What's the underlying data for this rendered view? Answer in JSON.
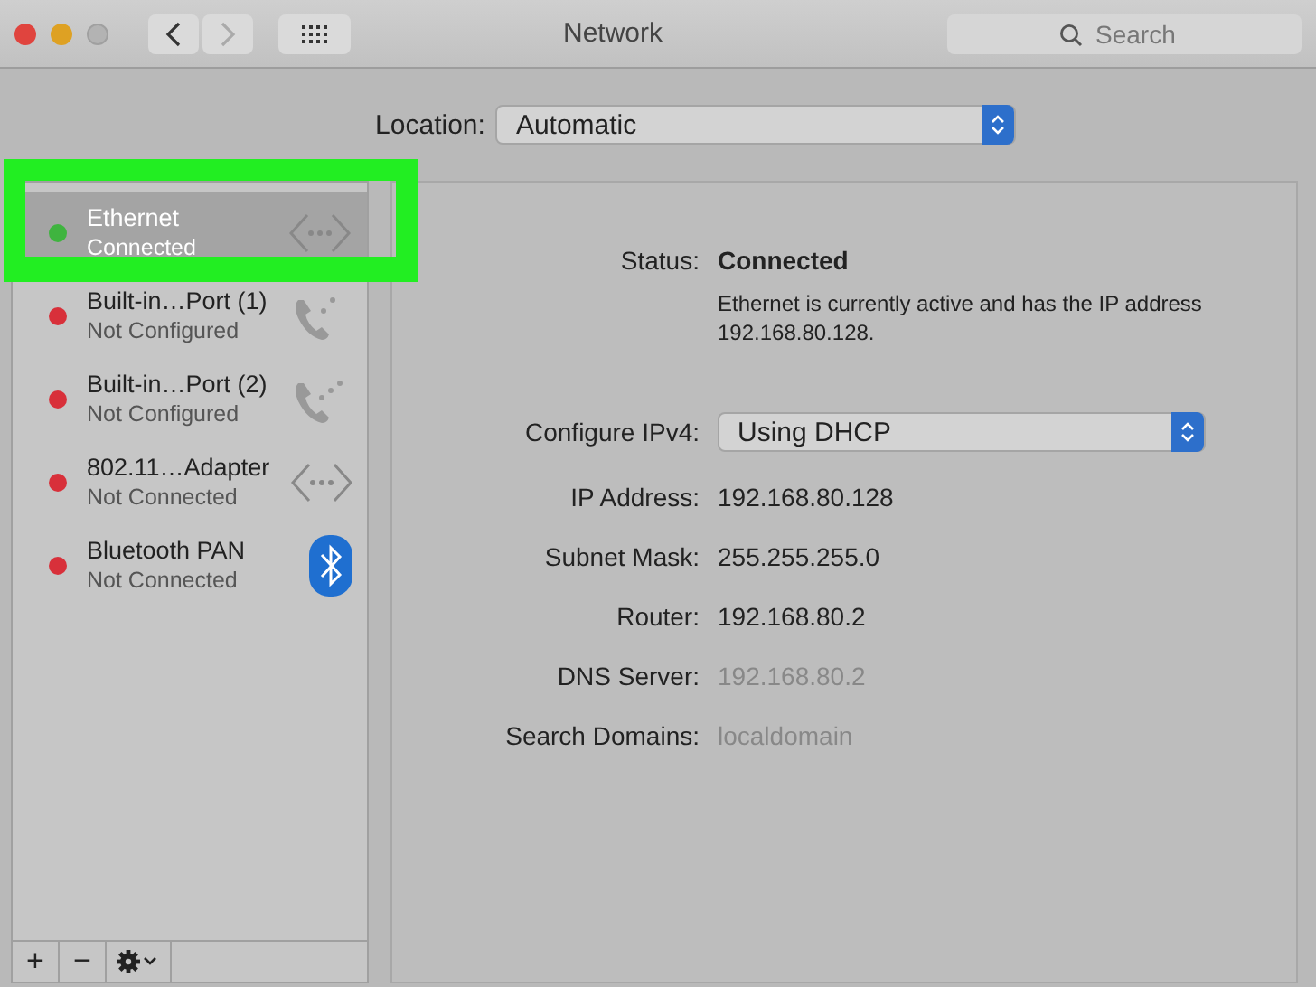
{
  "window": {
    "title": "Network"
  },
  "toolbar": {
    "search": {
      "placeholder": "Search"
    }
  },
  "location": {
    "label": "Location:",
    "value": "Automatic"
  },
  "services": [
    {
      "name": "Ethernet",
      "status": "Connected",
      "color": "#3fb43f",
      "kind": "ethernet",
      "selected": true
    },
    {
      "name": "Built-in…Port (1)",
      "status": "Not Configured",
      "color": "#d8303a",
      "kind": "phone",
      "selected": false
    },
    {
      "name": "Built-in…Port (2)",
      "status": "Not Configured",
      "color": "#d8303a",
      "kind": "phone-dots",
      "selected": false
    },
    {
      "name": "802.11…Adapter",
      "status": "Not Connected",
      "color": "#d8303a",
      "kind": "ethernet",
      "selected": false
    },
    {
      "name": "Bluetooth PAN",
      "status": "Not Connected",
      "color": "#d8303a",
      "kind": "bluetooth",
      "selected": false
    }
  ],
  "service_buttons": [
    "+",
    "−"
  ],
  "detail": {
    "status_label": "Status:",
    "status": "Connected",
    "description": "Ethernet is currently active and has the IP address 192.168.80.128.",
    "configure": {
      "label": "Configure IPv4:",
      "value": "Using DHCP"
    },
    "rows": [
      {
        "label": "IP Address:",
        "value": "192.168.80.128",
        "dimmed": false
      },
      {
        "label": "Subnet Mask:",
        "value": "255.255.255.0",
        "dimmed": false
      },
      {
        "label": "Router:",
        "value": "192.168.80.2",
        "dimmed": false
      },
      {
        "label": "DNS Server:",
        "value": "192.168.80.2",
        "dimmed": true
      },
      {
        "label": "Search Domains:",
        "value": "localdomain",
        "dimmed": true
      }
    ]
  },
  "highlight": {
    "on": true
  }
}
